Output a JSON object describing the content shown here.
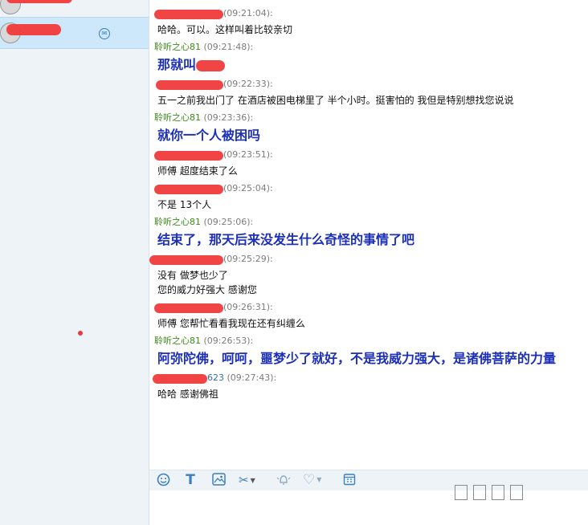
{
  "toolbar": {
    "emoji_icon": "smiley-icon",
    "font_icon": "text-format-icon",
    "image_icon": "image-icon",
    "screenshot_icon": "scissors-icon",
    "shake_icon": "bell-shake-icon",
    "favorite_icon": "heart-icon",
    "history_icon": "calendar-icon"
  },
  "colors": {
    "my_name": "#3a8a18",
    "my_text": "#1b2fb8",
    "selected": "#cde8fa"
  },
  "messages": [
    {
      "sender": "",
      "time": "(09:21:04):",
      "text": "哈哈。可以。这样叫着比较亲切"
    },
    {
      "sender": "聆听之心81",
      "time": "(09:21:48):",
      "text": "那就叫"
    },
    {
      "sender": "",
      "time": "(09:22:33):",
      "text": "五一之前我出门了  在酒店被困电梯里了  半个小时。挺害怕的  我但是特别想找您说说"
    },
    {
      "sender": "聆听之心81",
      "time": "(09:23:36):",
      "text": "就你一个人被困吗"
    },
    {
      "sender": "",
      "time": "(09:23:51):",
      "text": "师傅  超度结束了么"
    },
    {
      "sender": "",
      "time": "(09:25:04):",
      "text": "不是  13个人"
    },
    {
      "sender": "聆听之心81",
      "time": "(09:25:06):",
      "text": "结束了，那天后来没发生什么奇怪的事情了吧"
    },
    {
      "sender": "",
      "time": "(09:25:29):",
      "text": "没有  做梦也少了",
      "text2": "您的威力好强大  感谢您"
    },
    {
      "sender": "",
      "time": "(09:26:31):",
      "text": "师傅  您帮忙看看我现在还有纠缠么"
    },
    {
      "sender": "聆听之心81",
      "time": "(09:26:53):",
      "text": "阿弥陀佛，呵呵，噩梦少了就好，不是我威力强大，是诸佛菩萨的力量"
    },
    {
      "sender": "623",
      "time": "(09:27:43):",
      "text": "哈哈  感谢佛祖"
    }
  ]
}
